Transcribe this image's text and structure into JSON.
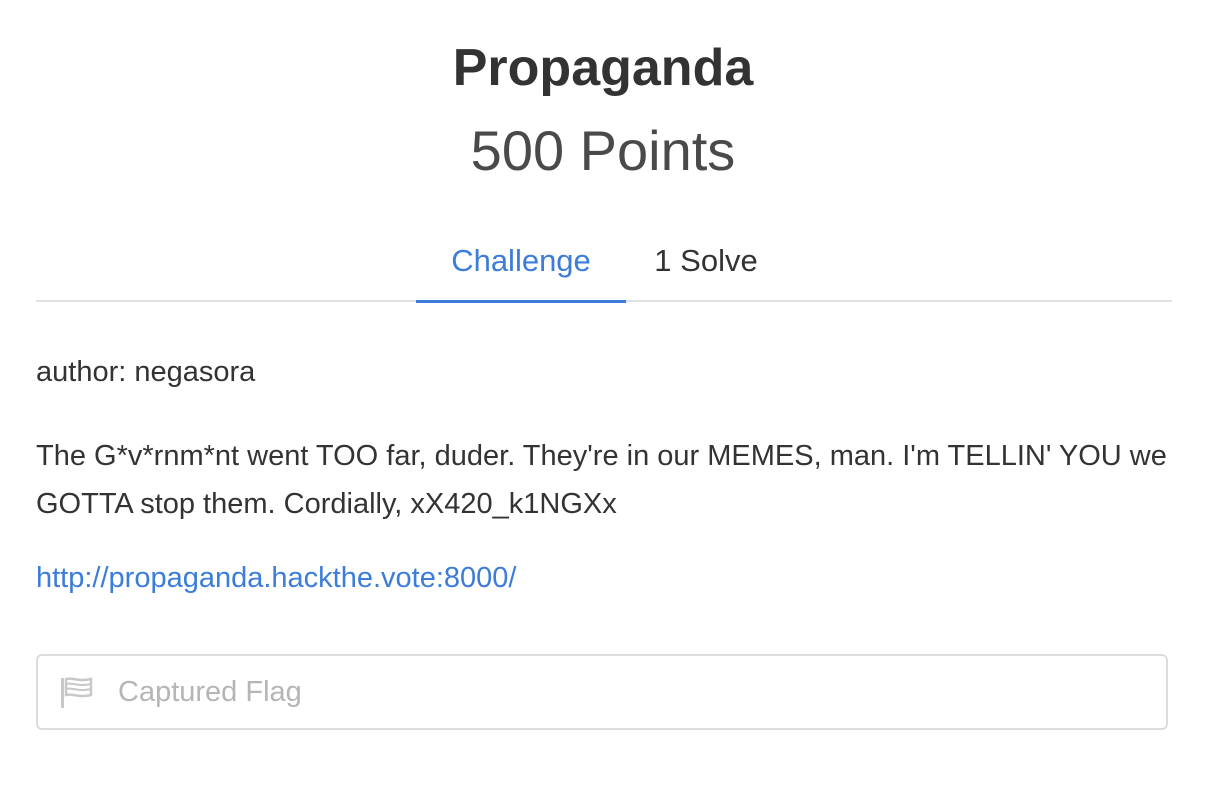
{
  "challenge": {
    "name": "Propaganda",
    "points": "500 Points"
  },
  "tabs": [
    {
      "label": "Challenge",
      "active": true
    },
    {
      "label": "1 Solve",
      "active": false
    }
  ],
  "content": {
    "author": "author: negasora",
    "description": "The G*v*rnm*nt went TOO far, duder. They're in our MEMES, man. I'm TELLIN' YOU we GOTTA stop them. Cordially, xX420_k1NGXx",
    "link": "http://propaganda.hackthe.vote:8000/"
  },
  "flag_input": {
    "placeholder": "Captured Flag",
    "value": "",
    "icon": "flag-icon"
  },
  "colors": {
    "accent": "#3b7dd8",
    "text": "#333333",
    "border": "#dcdcdc",
    "placeholder": "#b5b5b5"
  }
}
